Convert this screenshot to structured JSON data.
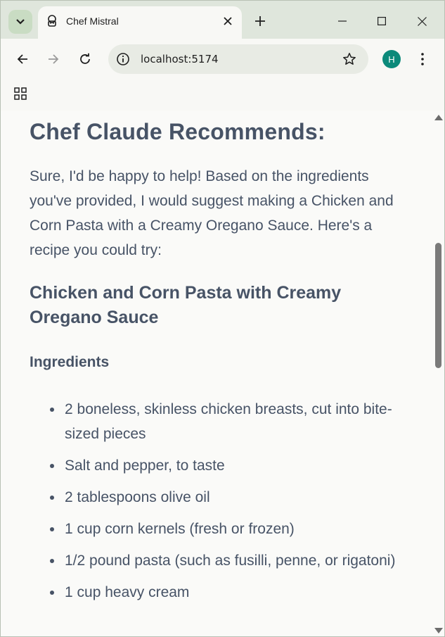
{
  "browser": {
    "tab": {
      "title": "Chef Mistral"
    },
    "address": {
      "url": "localhost:5174"
    },
    "profile": {
      "initial": "H"
    }
  },
  "page": {
    "heading": "Chef Claude Recommends:",
    "intro": "Sure, I'd be happy to help! Based on the ingredients you've provided, I would suggest making a Chicken and Corn Pasta with a Creamy Oregano Sauce. Here's a recipe you could try:",
    "recipe_title": "Chicken and Corn Pasta with Creamy Oregano Sauce",
    "ingredients_heading": "Ingredients",
    "ingredients": [
      "2 boneless, skinless chicken breasts, cut into bite-sized pieces",
      "Salt and pepper, to taste",
      "2 tablespoons olive oil",
      "1 cup corn kernels (fresh or frozen)",
      "1/2 pound pasta (such as fusilli, penne, or rigatoni)",
      "1 cup heavy cream"
    ]
  },
  "colors": {
    "text": "#475366",
    "page_bg": "#fafaf8",
    "frame_bg": "#dfe6dc",
    "avatar": "#0c8a7a"
  }
}
